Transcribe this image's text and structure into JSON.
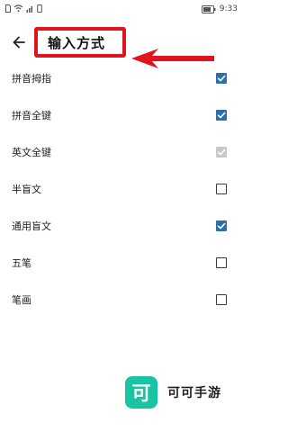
{
  "status_bar": {
    "time": "9:33",
    "icons": [
      "sim-icon",
      "wifi-icon",
      "signal-icon",
      "vibrate-icon",
      "battery-icon"
    ]
  },
  "toolbar": {
    "back_icon": "arrow-left-icon",
    "title": "输入方式"
  },
  "annotation": {
    "color": "#e0141e"
  },
  "settings": [
    {
      "label": "拼音拇指",
      "state": "checked"
    },
    {
      "label": "拼音全键",
      "state": "checked"
    },
    {
      "label": "英文全键",
      "state": "checked-disabled"
    },
    {
      "label": "半盲文",
      "state": "unchecked"
    },
    {
      "label": "通用盲文",
      "state": "checked"
    },
    {
      "label": "五笔",
      "state": "unchecked"
    },
    {
      "label": "笔画",
      "state": "unchecked"
    }
  ],
  "colors": {
    "accent": "#2e6ea8",
    "disabled": "#c8c8c8",
    "watermark": "#19c3a4"
  },
  "watermark": {
    "logo_char": "可",
    "text": "可可手游"
  }
}
